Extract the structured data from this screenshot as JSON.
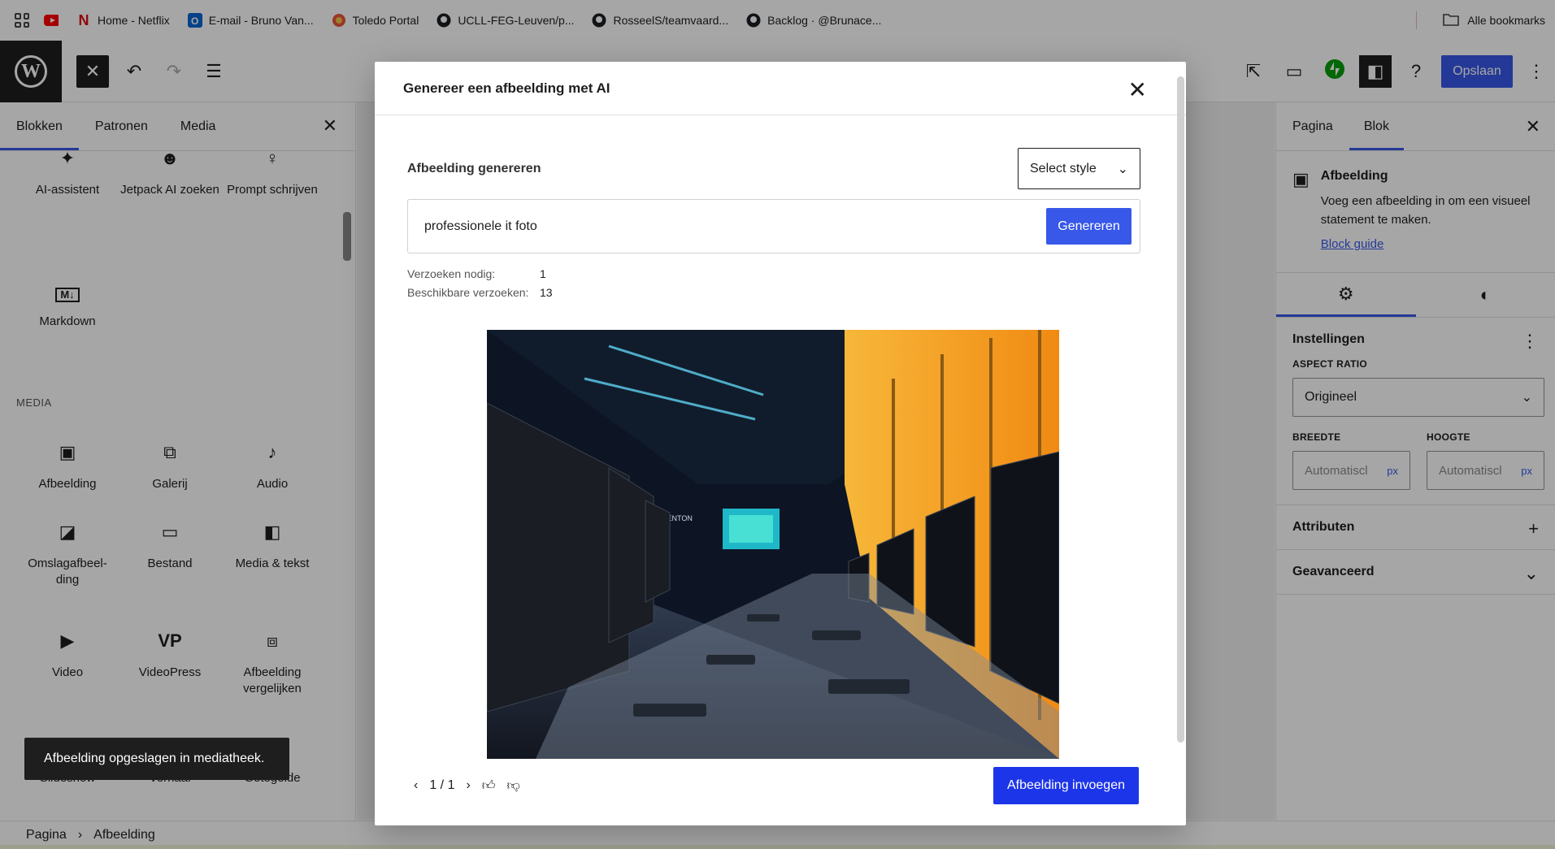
{
  "browser": {
    "bookmarks": [
      {
        "icon": "youtube-icon",
        "label": ""
      },
      {
        "icon": "netflix-icon",
        "label": "Home - Netflix"
      },
      {
        "icon": "outlook-icon",
        "label": "E-mail - Bruno Van..."
      },
      {
        "icon": "toledo-icon",
        "label": "Toledo Portal"
      },
      {
        "icon": "github-icon",
        "label": "UCLL-FEG-Leuven/p..."
      },
      {
        "icon": "github-icon",
        "label": "RosseelS/teamvaard..."
      },
      {
        "icon": "github-icon",
        "label": "Backlog · @Brunace..."
      }
    ],
    "all_bookmarks": "Alle bookmarks"
  },
  "toolbar": {
    "save_label": "Opslaan"
  },
  "inserter": {
    "tabs": [
      "Blokken",
      "Patronen",
      "Media"
    ],
    "top_items": [
      {
        "label": "AI-assistent",
        "icon": "sparkle-icon"
      },
      {
        "label": "Jetpack AI zoeken",
        "icon": "robot-icon"
      },
      {
        "label": "Prompt schrijven",
        "icon": "lightbulb-icon"
      }
    ],
    "markdown": {
      "label": "Markdown",
      "icon": "markdown-icon"
    },
    "media_heading": "MEDIA",
    "media_items": [
      {
        "label": "Afbeelding",
        "icon": "image-icon"
      },
      {
        "label": "Galerij",
        "icon": "gallery-icon"
      },
      {
        "label": "Audio",
        "icon": "audio-icon"
      },
      {
        "label": "Omslagafbeel-ding",
        "icon": "cover-icon"
      },
      {
        "label": "Bestand",
        "icon": "folder-icon"
      },
      {
        "label": "Media & tekst",
        "icon": "media-text-icon"
      },
      {
        "label": "Video",
        "icon": "video-icon"
      },
      {
        "label": "VideoPress",
        "icon": "videopress-icon"
      },
      {
        "label": "Afbeelding vergelijken",
        "icon": "image-compare-icon"
      },
      {
        "label": "Slideshow",
        "icon": "slideshow-icon"
      },
      {
        "label": "Verhaal",
        "icon": "story-icon"
      },
      {
        "label": "Getegelde",
        "icon": "tiled-gallery-icon"
      }
    ]
  },
  "snackbar": "Afbeelding opgeslagen in mediatheek.",
  "breadcrumb": [
    "Pagina",
    "Afbeelding"
  ],
  "settings": {
    "tabs": [
      "Pagina",
      "Blok"
    ],
    "block_title": "Afbeelding",
    "block_desc": "Voeg een afbeelding in om een visueel statement te maken.",
    "block_guide": "Block guide",
    "instellingen": "Instellingen",
    "aspect_ratio_label": "ASPECT RATIO",
    "aspect_ratio_value": "Origineel",
    "breedte_label": "BREEDTE",
    "hoogte_label": "HOOGTE",
    "dim_placeholder": "Automatiscl",
    "unit": "px",
    "attributen": "Attributen",
    "geavanceerd": "Geavanceerd"
  },
  "modal": {
    "title": "Genereer een afbeelding met AI",
    "section_label": "Afbeelding genereren",
    "style_select": "Select style",
    "prompt": "professionele it foto",
    "generate_button": "Genereren",
    "requests_needed_label": "Verzoeken nodig:",
    "requests_needed_value": "1",
    "available_label": "Beschikbare verzoeken:",
    "available_value": "13",
    "image_text_1": "CENTON",
    "pager": "1 / 1",
    "insert_button": "Afbeelding invoegen"
  }
}
